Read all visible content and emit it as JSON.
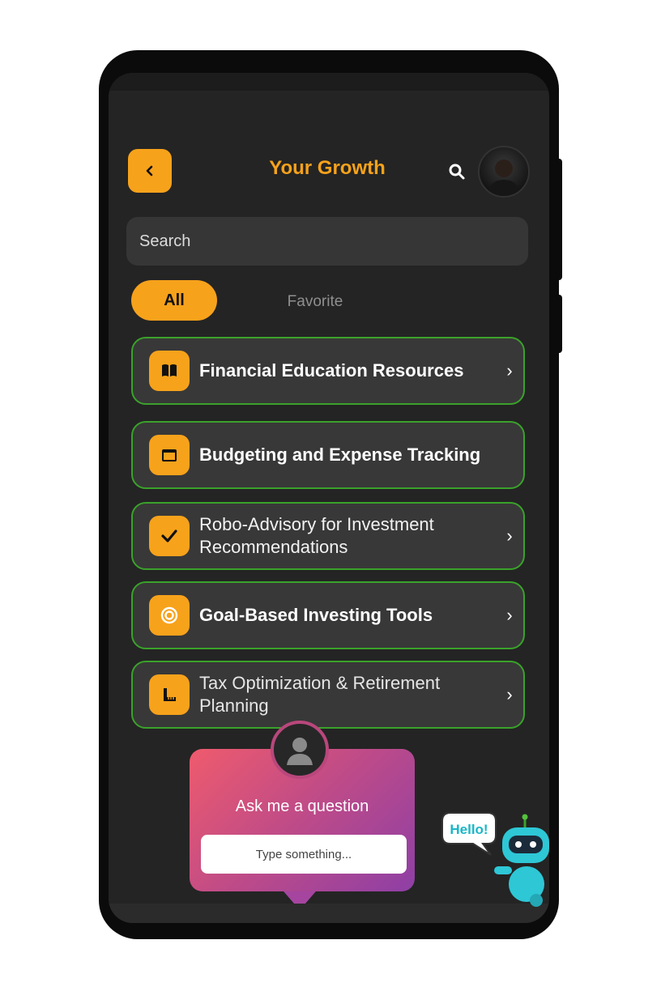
{
  "header": {
    "title": "Your Growth"
  },
  "search": {
    "placeholder": "Search"
  },
  "tabs": [
    {
      "label": "All",
      "active": true
    },
    {
      "label": "Favorite",
      "active": false
    }
  ],
  "menu": [
    {
      "label": "Financial Education Resources",
      "icon": "book-icon"
    },
    {
      "label": "Budgeting and Expense Tracking",
      "icon": "wallet-icon"
    },
    {
      "label": "Robo-Advisory for Investment Recommendations",
      "icon": "checkmark-icon"
    },
    {
      "label": "Goal-Based Investing Tools",
      "icon": "target-icon"
    },
    {
      "label": "Tax Optimization & Retirement Planning",
      "icon": "ruler-icon"
    }
  ],
  "assistant": {
    "prompt": "Ask me a question",
    "input_placeholder": "Type something...",
    "bubble": "Hello!"
  },
  "colors": {
    "accent": "#f7a21b",
    "card_border": "#3aa22a",
    "screen_bg": "#242424",
    "card_bg": "#383838"
  }
}
